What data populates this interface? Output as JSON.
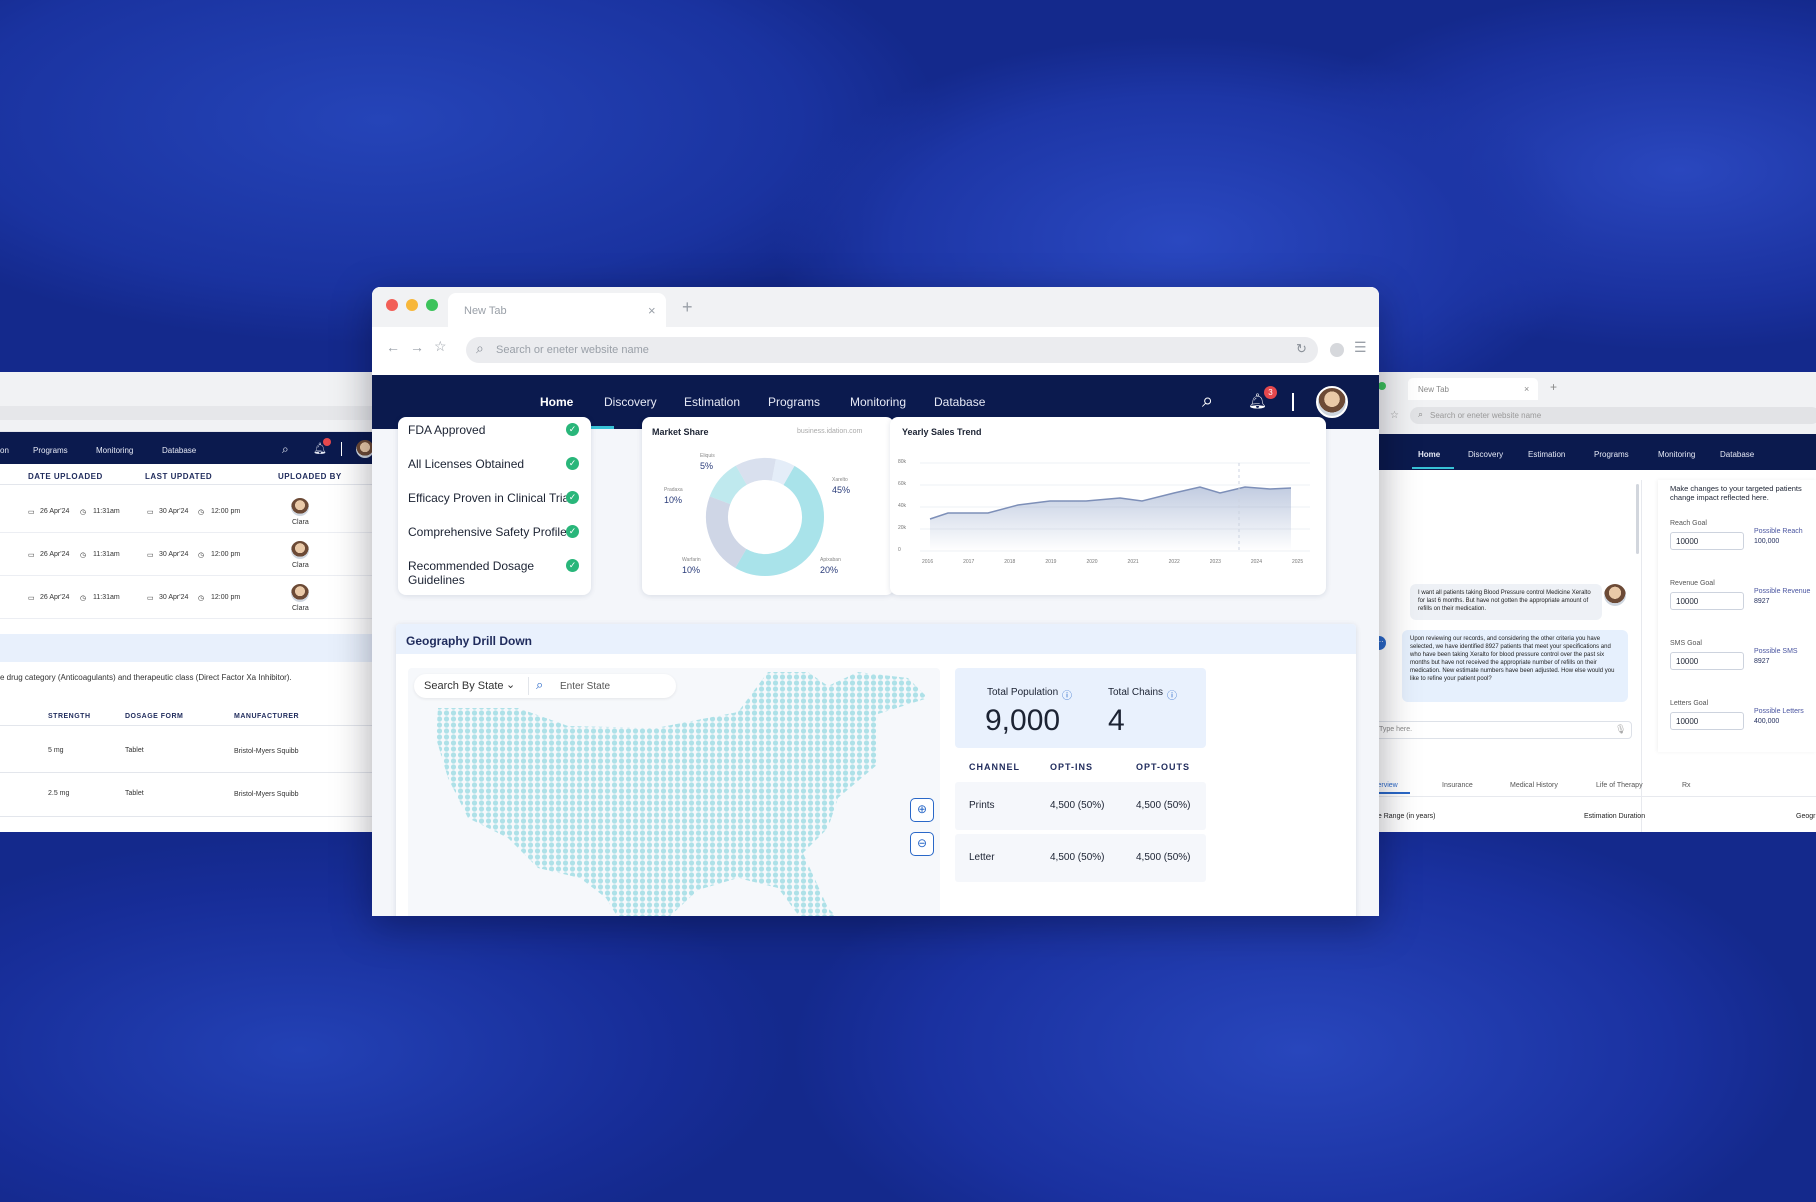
{
  "main": {
    "tab_title": "New Tab",
    "tab_close": "×",
    "new_tab": "+",
    "address_placeholder": "Search or eneter website name",
    "nav": [
      "Home",
      "Discovery",
      "Estimation",
      "Programs",
      "Monitoring",
      "Database"
    ],
    "active_nav": "Home",
    "notification_count": "3",
    "criteria": [
      "FDA Approved",
      "All Licenses Obtained",
      "Efficacy Proven in Clinical Trials",
      "Comprehensive Safety Profile",
      "Recommended Dosage Guidelines"
    ],
    "market_share": {
      "title": "Market Share",
      "link": "business.idation.com",
      "segments": [
        {
          "name": "Xarelto",
          "value": "45%"
        },
        {
          "name": "Apixaban",
          "value": "20%"
        },
        {
          "name": "Warfarin",
          "value": "10%"
        },
        {
          "name": "Pradaxa",
          "value": "10%"
        },
        {
          "name": "Eliquis",
          "value": "5%"
        }
      ]
    },
    "trend": {
      "title": "Yearly Sales Trend",
      "y_ticks": [
        "80k",
        "60k",
        "40k",
        "20k",
        "0"
      ],
      "x_ticks": [
        "2016",
        "2017",
        "2018",
        "2019",
        "2020",
        "2021",
        "2022",
        "2023",
        "2024",
        "2025"
      ]
    },
    "geo": {
      "title": "Geography Drill Down",
      "search_select": "Search By State",
      "state_placeholder": "Enter State",
      "total_population_label": "Total Population",
      "total_population": "9,000",
      "total_chains_label": "Total Chains",
      "total_chains": "4",
      "cols": [
        "CHANNEL",
        "OPT-INS",
        "OPT-OUTS"
      ],
      "rows": [
        {
          "channel": "Prints",
          "in": "4,500 (50%)",
          "out": "4,500 (50%)"
        },
        {
          "channel": "Letter",
          "in": "4,500 (50%)",
          "out": "4,500 (50%)"
        }
      ]
    }
  },
  "left": {
    "nav": [
      "on",
      "Programs",
      "Monitoring",
      "Database"
    ],
    "cols": [
      "DATE UPLOADED",
      "LAST UPDATED",
      "UPLOADED BY"
    ],
    "rows": [
      {
        "d1": "26 Apr'24",
        "t1": "11:31am",
        "d2": "30 Apr'24",
        "t2": "12:00 pm",
        "user": "Clara"
      },
      {
        "d1": "26 Apr'24",
        "t1": "11:31am",
        "d2": "30 Apr'24",
        "t2": "12:00 pm",
        "user": "Clara"
      },
      {
        "d1": "26 Apr'24",
        "t1": "11:31am",
        "d2": "30 Apr'24",
        "t2": "12:00 pm",
        "user": "Clara"
      }
    ],
    "description": "e drug category (Anticoagulants) and therapeutic class (Direct Factor Xa Inhibitor).",
    "cols2": [
      "STRENGTH",
      "DOSAGE FORM",
      "MANUFACTURER"
    ],
    "rows2": [
      {
        "s": "5 mg",
        "f": "Tablet",
        "m": "Bristol-Myers Squibb"
      },
      {
        "s": "2.5 mg",
        "f": "Tablet",
        "m": "Bristol-Myers Squibb"
      }
    ]
  },
  "right": {
    "tab_title": "New Tab",
    "address_placeholder": "Search or eneter website name",
    "nav": [
      "Home",
      "Discovery",
      "Estimation",
      "Programs",
      "Monitoring",
      "Database"
    ],
    "user_msg": "I want all patients taking Blood Pressure control Medicine Xeralto for last 6 months. But have not gotten the appropriate amount of refills on their medication.",
    "bot_msg": "Upon reviewing our records, and considering the other criteria you have selected, we have identified 8927 patients that meet your specifications and who have been taking Xeralto for blood pressure control over the past six months but have not received the appropriate number of refills on their medication. New estimate numbers have been adjusted. How else would you like to refine your patient pool?",
    "input_placeholder": "Type here.",
    "panel_title": "Make changes to your targeted patients change impact reflected here.",
    "goals": [
      {
        "label": "Reach Goal",
        "value": "10000",
        "possible_label": "Possible Reach",
        "possible": "100,000"
      },
      {
        "label": "Revenue Goal",
        "value": "10000",
        "possible_label": "Possible Revenue",
        "possible": "8927"
      },
      {
        "label": "SMS Goal",
        "value": "10000",
        "possible_label": "Possible SMS",
        "possible": "8927"
      },
      {
        "label": "Letters Goal",
        "value": "10000",
        "possible_label": "Possible Letters",
        "possible": "400,000"
      }
    ],
    "tabs": [
      "verview",
      "Insurance",
      "Medical History",
      "Life of Therapy",
      "Rx"
    ],
    "field1": "ge Range (in years)",
    "field2": "Estimation Duration",
    "field3": "Geogr"
  },
  "colors": {
    "navy": "#0b1a4e",
    "accent": "#2a68c8",
    "teal": "#a9e3ea",
    "success": "#29b67a",
    "badge": "#e5484d"
  }
}
